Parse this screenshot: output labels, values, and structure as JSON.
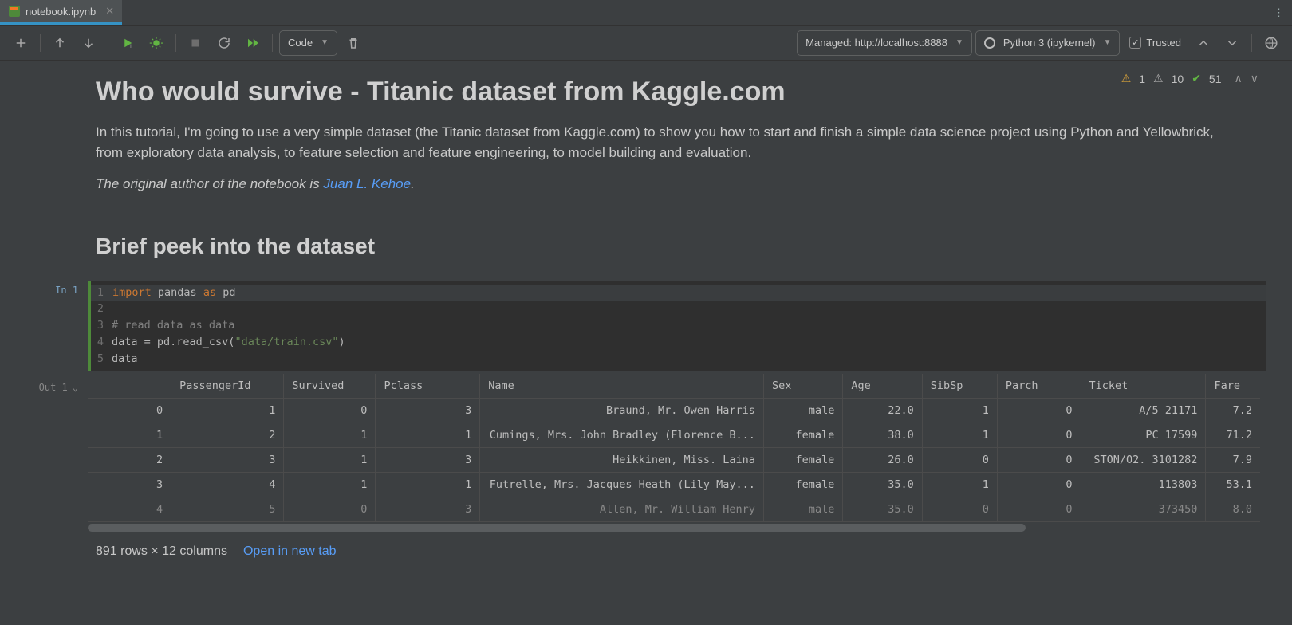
{
  "tab": {
    "filename": "notebook.ipynb"
  },
  "toolbar": {
    "cell_type": "Code",
    "server": "Managed: http://localhost:8888",
    "kernel": "Python 3 (ipykernel)",
    "trusted": "Trusted"
  },
  "status": {
    "warn1": "1",
    "warn2": "10",
    "ok": "51"
  },
  "markdown": {
    "title": "Who would survive - Titanic dataset from Kaggle.com",
    "intro": "In this tutorial, I'm going to use a very simple dataset (the Titanic dataset from Kaggle.com) to show you how to start and finish a simple data science project using Python and Yellowbrick, from exploratory data analysis, to feature selection and feature engineering, to model building and evaluation.",
    "orig_prefix": "The original author of the notebook is ",
    "orig_link": "Juan L. Kehoe",
    "orig_suffix": ".",
    "subtitle": "Brief peek into the dataset"
  },
  "code": {
    "prompt": "In 1",
    "lines": [
      {
        "n": "1",
        "kind": "import"
      },
      {
        "n": "2",
        "kind": "blank"
      },
      {
        "n": "3",
        "kind": "comment",
        "text": "# read data as data"
      },
      {
        "n": "4",
        "kind": "read"
      },
      {
        "n": "5",
        "kind": "var",
        "text": "data"
      }
    ],
    "tokens": {
      "import": "import",
      "pandas": "pandas",
      "as": "as",
      "pd": "pd",
      "assign": "data = pd.read_csv(",
      "path": "\"data/train.csv\"",
      "close": ")"
    }
  },
  "output": {
    "prompt": "Out 1",
    "columns": [
      "",
      "PassengerId",
      "Survived",
      "Pclass",
      "Name",
      "Sex",
      "Age",
      "SibSp",
      "Parch",
      "Ticket",
      "Fare"
    ],
    "rows": [
      [
        "0",
        "1",
        "0",
        "3",
        "Braund, Mr. Owen Harris",
        "male",
        "22.0",
        "1",
        "0",
        "A/5 21171",
        "7.2"
      ],
      [
        "1",
        "2",
        "1",
        "1",
        "Cumings, Mrs. John Bradley (Florence B...",
        "female",
        "38.0",
        "1",
        "0",
        "PC 17599",
        "71.2"
      ],
      [
        "2",
        "3",
        "1",
        "3",
        "Heikkinen, Miss. Laina",
        "female",
        "26.0",
        "0",
        "0",
        "STON/O2. 3101282",
        "7.9"
      ],
      [
        "3",
        "4",
        "1",
        "1",
        "Futrelle, Mrs. Jacques Heath (Lily May...",
        "female",
        "35.0",
        "1",
        "0",
        "113803",
        "53.1"
      ],
      [
        "4",
        "5",
        "0",
        "3",
        "Allen, Mr. William Henry",
        "male",
        "35.0",
        "0",
        "0",
        "373450",
        "8.0"
      ]
    ],
    "summary": "891 rows × 12 columns",
    "open_tab": "Open in new tab"
  },
  "chart_data": {
    "type": "table",
    "title": "Titanic train.csv head",
    "columns": [
      "PassengerId",
      "Survived",
      "Pclass",
      "Name",
      "Sex",
      "Age",
      "SibSp",
      "Parch",
      "Ticket",
      "Fare"
    ],
    "rows": [
      {
        "PassengerId": 1,
        "Survived": 0,
        "Pclass": 3,
        "Name": "Braund, Mr. Owen Harris",
        "Sex": "male",
        "Age": 22.0,
        "SibSp": 1,
        "Parch": 0,
        "Ticket": "A/5 21171",
        "Fare": 7.2
      },
      {
        "PassengerId": 2,
        "Survived": 1,
        "Pclass": 1,
        "Name": "Cumings, Mrs. John Bradley (Florence B...)",
        "Sex": "female",
        "Age": 38.0,
        "SibSp": 1,
        "Parch": 0,
        "Ticket": "PC 17599",
        "Fare": 71.2
      },
      {
        "PassengerId": 3,
        "Survived": 1,
        "Pclass": 3,
        "Name": "Heikkinen, Miss. Laina",
        "Sex": "female",
        "Age": 26.0,
        "SibSp": 0,
        "Parch": 0,
        "Ticket": "STON/O2. 3101282",
        "Fare": 7.9
      },
      {
        "PassengerId": 4,
        "Survived": 1,
        "Pclass": 1,
        "Name": "Futrelle, Mrs. Jacques Heath (Lily May...)",
        "Sex": "female",
        "Age": 35.0,
        "SibSp": 1,
        "Parch": 0,
        "Ticket": "113803",
        "Fare": 53.1
      },
      {
        "PassengerId": 5,
        "Survived": 0,
        "Pclass": 3,
        "Name": "Allen, Mr. William Henry",
        "Sex": "male",
        "Age": 35.0,
        "SibSp": 0,
        "Parch": 0,
        "Ticket": "373450",
        "Fare": 8.0
      }
    ],
    "total_rows": 891,
    "total_columns": 12
  }
}
